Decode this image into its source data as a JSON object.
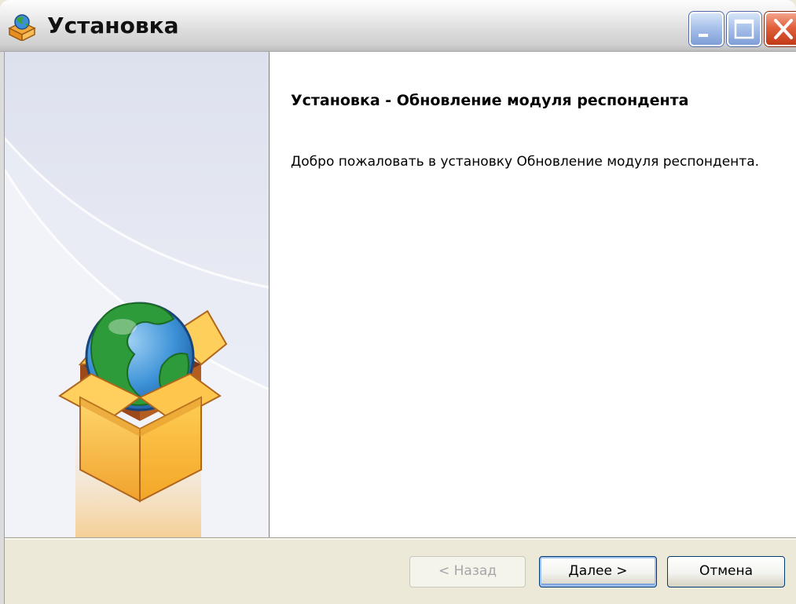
{
  "window": {
    "title": "Установка",
    "icon": "installer-globe-box-icon"
  },
  "caption_buttons": {
    "minimize": "minimize-icon",
    "maximize": "maximize-icon",
    "close": "close-icon"
  },
  "sidebar": {
    "illustration": "globe-in-box-icon"
  },
  "content": {
    "heading": "Установка - Обновление модуля респондента",
    "welcome": "Добро пожаловать в установку Обновление модуля респондента."
  },
  "footer": {
    "back_label": "< Назад",
    "next_label": "Далее >",
    "cancel_label": "Отмена",
    "back_enabled": false
  },
  "colors": {
    "titlebar": "#dcdcdc",
    "close_button": "#e2603c",
    "default_button_border": "#003c74",
    "disabled_text": "#a7a6aa",
    "dialog_face": "#ece9d8"
  }
}
